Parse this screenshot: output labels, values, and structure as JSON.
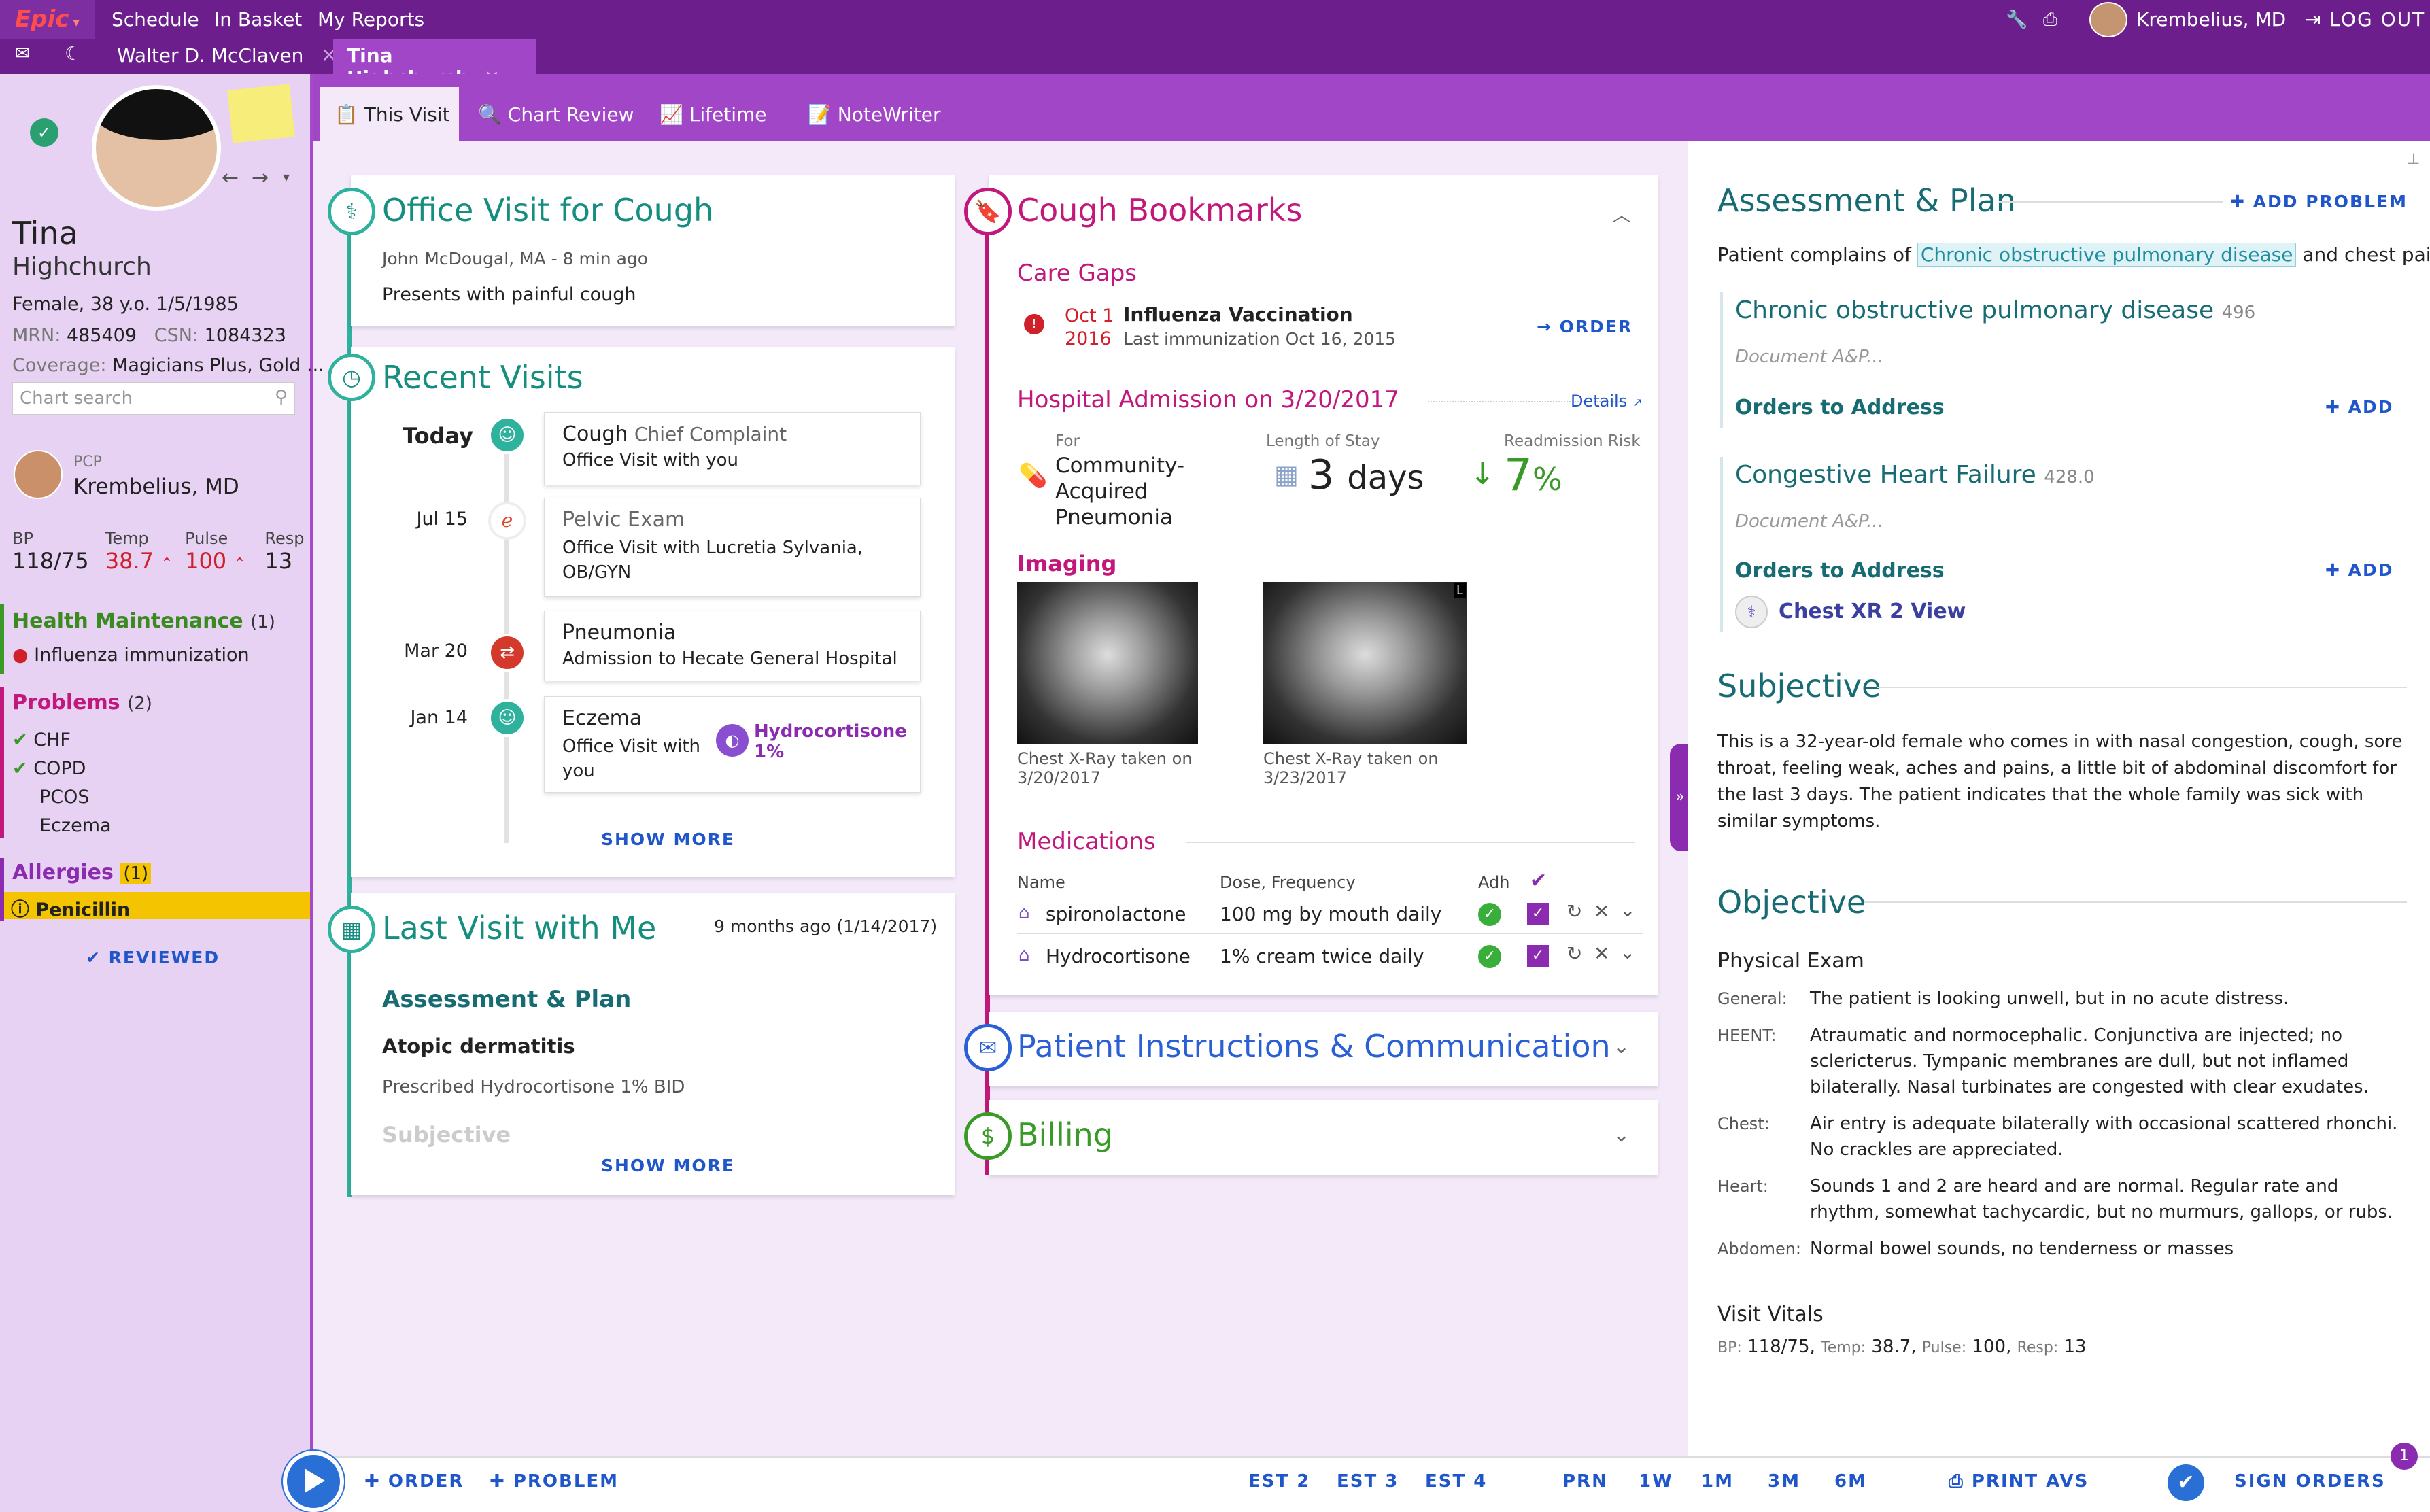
{
  "app": {
    "logo": "Epic",
    "menu": [
      "Schedule",
      "In Basket",
      "My Reports"
    ],
    "user": "Krembelius, MD",
    "logout": "LOG OUT"
  },
  "patient_tabs": [
    {
      "label": "Walter D. McClaven"
    },
    {
      "label": "Tina Highchurch"
    }
  ],
  "nav_tabs": [
    {
      "label": "This Visit"
    },
    {
      "label": "Chart Review"
    },
    {
      "label": "Lifetime"
    },
    {
      "label": "NoteWriter"
    }
  ],
  "sidebar": {
    "first_name": "Tina",
    "last_name": "Highchurch",
    "demographics": "Female, 38 y.o. 1/5/1985",
    "mrn_label": "MRN:",
    "mrn": "485409",
    "csn_label": "CSN:",
    "csn": "1084323",
    "coverage_label": "Coverage:",
    "coverage": "Magicians Plus, Gold ...",
    "search_placeholder": "Chart search",
    "pcp_label": "PCP",
    "pcp": "Krembelius, MD",
    "vitals": [
      {
        "label": "BP",
        "value": "118/75",
        "abnormal": false
      },
      {
        "label": "Temp",
        "value": "38.7",
        "abnormal": true
      },
      {
        "label": "Pulse",
        "value": "100",
        "abnormal": true
      },
      {
        "label": "Resp",
        "value": "13",
        "abnormal": false
      }
    ],
    "health_maintenance": {
      "title": "Health Maintenance",
      "count": "(1)",
      "items": [
        "Influenza immunization"
      ]
    },
    "problems": {
      "title": "Problems",
      "count": "(2)",
      "items": [
        {
          "label": "CHF",
          "checked": true
        },
        {
          "label": "COPD",
          "checked": true
        },
        {
          "label": "PCOS",
          "checked": false
        },
        {
          "label": "Eczema",
          "checked": false
        }
      ]
    },
    "allergies": {
      "title": "Allergies",
      "count": "(1)",
      "items": [
        "Penicillin"
      ]
    },
    "reviewed": "REVIEWED"
  },
  "office_visit": {
    "title": "Office Visit for Cough",
    "author": "John McDougal, MA - 8 min ago",
    "text": "Presents with painful cough"
  },
  "recent_visits": {
    "title": "Recent Visits",
    "show_more": "SHOW MORE",
    "items": [
      {
        "date": "Today",
        "title": "Cough",
        "subtitle": "Chief Complaint",
        "detail": "Office Visit with you"
      },
      {
        "date": "Jul 15",
        "title": "Pelvic Exam",
        "subtitle": "",
        "detail": "Office Visit with Lucretia Sylvania, OB/GYN"
      },
      {
        "date": "Mar 20",
        "title": "Pneumonia",
        "subtitle": "",
        "detail": "Admission to Hecate General Hospital"
      },
      {
        "date": "Jan 14",
        "title": "Eczema",
        "subtitle": "",
        "detail": "Office Visit with you",
        "med": "Hydrocortisone 1%"
      }
    ]
  },
  "last_visit": {
    "title": "Last Visit with Me",
    "when": "9 months ago (1/14/2017)",
    "ap_heading": "Assessment & Plan",
    "dx": "Atopic dermatitis",
    "rx": "Prescribed Hydrocortisone 1% BID",
    "faded": "Subjective",
    "show_more": "SHOW MORE"
  },
  "bookmarks": {
    "title": "Cough Bookmarks",
    "care_gaps": {
      "heading": "Care Gaps",
      "date1": "Oct 1",
      "date2": "2016",
      "name": "Influenza Vaccination",
      "last": "Last immunization Oct 16, 2015",
      "action": "ORDER"
    },
    "admission": {
      "heading": "Hospital Admission on 3/20/2017",
      "details": "Details",
      "for_label": "For",
      "for_value": "Community-Acquired Pneumonia",
      "los_label": "Length of Stay",
      "los_value": "3",
      "los_unit": "days",
      "risk_label": "Readmission Risk",
      "risk_value": "7",
      "risk_unit": "%"
    },
    "imaging": {
      "heading": "Imaging",
      "items": [
        {
          "caption": "Chest X-Ray taken on 3/20/2017"
        },
        {
          "caption": "Chest X-Ray taken on 3/23/2017",
          "marker": "L"
        }
      ]
    },
    "medications": {
      "heading": "Medications",
      "col_name": "Name",
      "col_dose": "Dose, Frequency",
      "col_adh": "Adh",
      "rows": [
        {
          "name": "spironolactone",
          "dose": "100 mg by mouth daily"
        },
        {
          "name": "Hydrocortisone",
          "dose": "1% cream twice daily"
        }
      ]
    }
  },
  "instructions": {
    "title": "Patient Instructions & Communication"
  },
  "billing": {
    "title": "Billing"
  },
  "ap": {
    "title": "Assessment & Plan",
    "add_problem": "ADD PROBLEM",
    "complaint_pre": "Patient complains of",
    "complaint_link": "Chronic obstructive pulmonary disease",
    "complaint_post": "and chest pain.",
    "problems": [
      {
        "name": "Chronic obstructive pulmonary disease",
        "code": "496",
        "placeholder": "Document A&P...",
        "orders_label": "Orders to Address",
        "add": "ADD",
        "orders": []
      },
      {
        "name": "Congestive Heart Failure",
        "code": "428.0",
        "placeholder": "Document A&P...",
        "orders_label": "Orders to Address",
        "add": "ADD",
        "orders": [
          "Chest XR 2 View"
        ]
      }
    ]
  },
  "subjective": {
    "title": "Subjective",
    "text": "This is a 32-year-old female who comes in with nasal congestion, cough, sore throat, feeling weak, aches and pains, a little bit of abdominal discomfort for the last 3 days. The patient indicates that the whole family was sick with similar symptoms."
  },
  "objective": {
    "title": "Objective",
    "exam_heading": "Physical Exam",
    "exam": [
      {
        "label": "General:",
        "text": "The patient is looking unwell, but in no acute distress."
      },
      {
        "label": "HEENT:",
        "text": "Atraumatic and normocephalic. Conjunctiva are injected; no sclericterus. Tympanic membranes are dull, but not inflamed bilaterally. Nasal turbinates are congested with clear exudates."
      },
      {
        "label": "Chest:",
        "text": "Air entry is adequate bilaterally with occasional scattered rhonchi. No crackles are appreciated."
      },
      {
        "label": "Heart:",
        "text": "Sounds 1 and 2 are heard and are normal. Regular rate and rhythm, somewhat tachycardic, but no murmurs, gallops, or rubs."
      },
      {
        "label": "Abdomen:",
        "text": "Normal bowel sounds, no tenderness or masses"
      }
    ],
    "vitals_heading": "Visit Vitals",
    "bp_l": "BP:",
    "bp": "118/75,",
    "temp_l": "Temp:",
    "temp": "38.7,",
    "pulse_l": "Pulse:",
    "pulse": "100,",
    "resp_l": "Resp:",
    "resp": "13"
  },
  "bottom": {
    "order": "ORDER",
    "problem": "PROBLEM",
    "est2": "EST 2",
    "est3": "EST 3",
    "est4": "EST 4",
    "prn": "PRN",
    "w1": "1W",
    "m1": "1M",
    "m3": "3M",
    "m6": "6M",
    "print": "PRINT AVS",
    "sign": "SIGN ORDERS",
    "badge": "1"
  },
  "colors": {
    "purple_dark": "#6b1e8c",
    "purple_nav": "#a046c7",
    "teal": "#168e7f",
    "magenta": "#c2187c",
    "blue": "#2a5fd6",
    "green": "#3a9a28"
  }
}
